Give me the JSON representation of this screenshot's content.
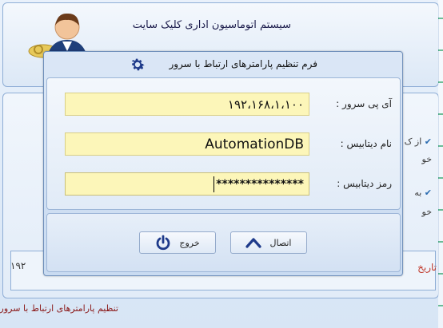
{
  "app": {
    "title": "سیستم اتوماسیون اداری کلیک سایت",
    "status_text": "تنظیم پارامترهای ارتباط با سرور",
    "background_right_lines": [
      "از ک",
      "خو",
      "به",
      "خو"
    ],
    "background_left_number": "۱۹۲",
    "background_date_label": "تاریخ"
  },
  "dialog": {
    "title": "فرم تنظیم پارامترهای ارتباط با سرور",
    "icon": "gear-icon",
    "fields": [
      {
        "label": "آی پی سرور :",
        "value": "۱۹۲،۱۶۸،۱،۱۰۰"
      },
      {
        "label": "نام دیتابیس :",
        "value": "AutomationDB"
      },
      {
        "label": "رمز دیتابیس :",
        "value": "***************"
      }
    ],
    "buttons": {
      "connect_label": "اتصال",
      "exit_label": "خروج"
    }
  },
  "colors": {
    "input_bg": "#fcf6b9",
    "accent": "#1e3a8a",
    "status_text": "#8b1a1a"
  }
}
